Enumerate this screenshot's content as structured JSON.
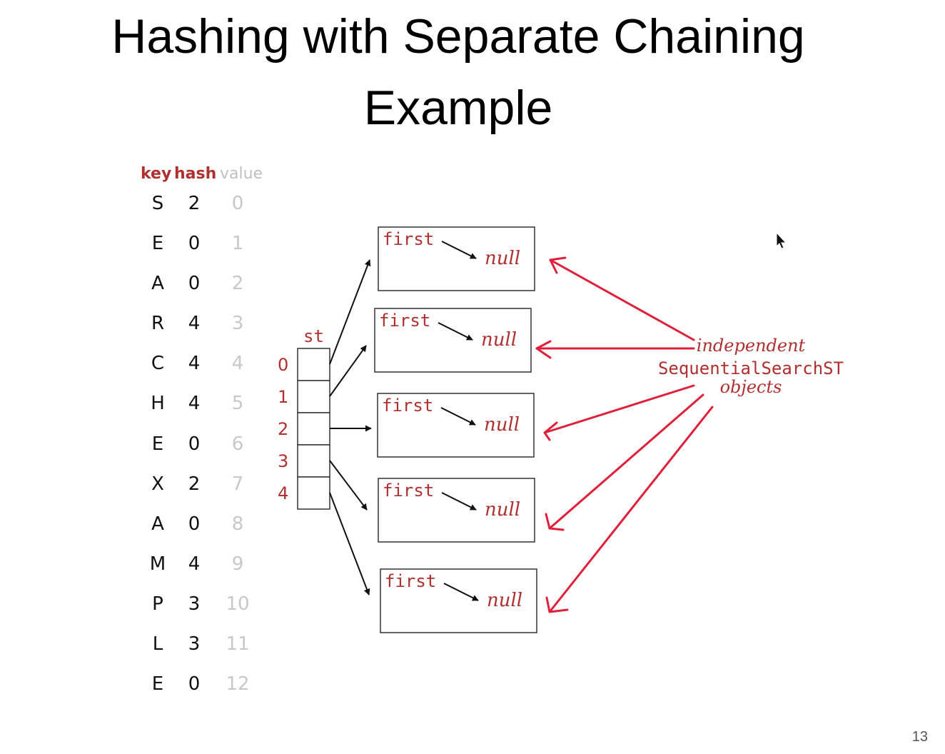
{
  "slide": {
    "title_line_1": "Hashing with Separate Chaining",
    "title_line_2": "Example",
    "page_number": "13"
  },
  "table": {
    "headers": {
      "key": "key",
      "hash": "hash",
      "value": "value"
    },
    "rows": [
      {
        "key": "S",
        "hash": "2",
        "value": "0"
      },
      {
        "key": "E",
        "hash": "0",
        "value": "1"
      },
      {
        "key": "A",
        "hash": "0",
        "value": "2"
      },
      {
        "key": "R",
        "hash": "4",
        "value": "3"
      },
      {
        "key": "C",
        "hash": "4",
        "value": "4"
      },
      {
        "key": "H",
        "hash": "4",
        "value": "5"
      },
      {
        "key": "E",
        "hash": "0",
        "value": "6"
      },
      {
        "key": "X",
        "hash": "2",
        "value": "7"
      },
      {
        "key": "A",
        "hash": "0",
        "value": "8"
      },
      {
        "key": "M",
        "hash": "4",
        "value": "9"
      },
      {
        "key": "P",
        "hash": "3",
        "value": "10"
      },
      {
        "key": "L",
        "hash": "3",
        "value": "11"
      },
      {
        "key": "E",
        "hash": "0",
        "value": "12"
      }
    ]
  },
  "array": {
    "label": "st",
    "indices": [
      "0",
      "1",
      "2",
      "3",
      "4"
    ]
  },
  "lists": [
    {
      "first": "first",
      "null": "null"
    },
    {
      "first": "first",
      "null": "null"
    },
    {
      "first": "first",
      "null": "null"
    },
    {
      "first": "first",
      "null": "null"
    },
    {
      "first": "first",
      "null": "null"
    }
  ],
  "annotation": {
    "line_1": "independent",
    "line_2": "SequentialSearchST",
    "line_3": "objects"
  },
  "colors": {
    "accent_red": "#b03030",
    "arrow_red": "#e0203a",
    "value_gray": "#c0c0c0"
  }
}
